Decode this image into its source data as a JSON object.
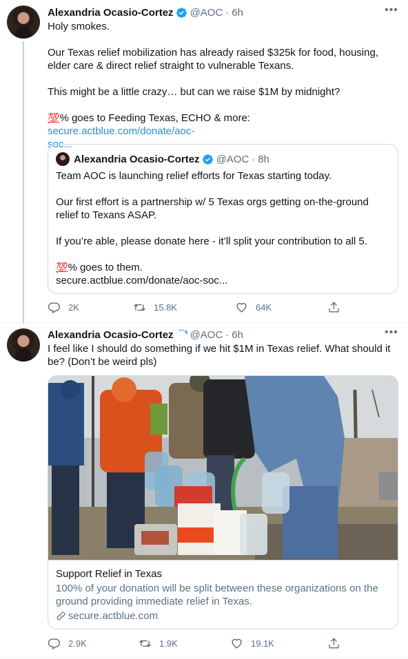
{
  "tweet1": {
    "author_name": "Alexandria Ocasio-Cortez",
    "handle": "@AOC",
    "separator": "·",
    "time": "6h",
    "more_icon": "more-horizontal-icon",
    "lines": [
      "Holy smokes.",
      "Our Texas relief mobilization has already raised $325k for food, housing,",
      "elder care & direct relief straight to vulnerable Texans.",
      "This might be a little crazy… but can we raise $1M by midnight?"
    ],
    "emoji": "💯",
    "last_line_text": "% goes to Feeding Texas, ECHO & more: ",
    "link_part1": "secure.actblue.com/donate/aoc-",
    "link_part2": "soc..."
  },
  "quote": {
    "author_name": "Alexandria Ocasio-Cortez",
    "handle": "@AOC",
    "separator": "·",
    "time": "8h",
    "lines": [
      "Team AOC is launching relief efforts for Texas starting today.",
      "Our first effort is a partnership w/ 5 Texas orgs getting on-the-ground",
      "relief to Texans ASAP.",
      "If you’re able, please donate here - it’ll split your contribution to all 5."
    ],
    "emoji": "💯",
    "last_line_text": "% goes to them.",
    "link": "secure.actblue.com/donate/aoc-soc..."
  },
  "actions1": {
    "replies": "2K",
    "retweets": "15.8K",
    "likes": "64K"
  },
  "tweet2": {
    "author_name": "Alexandria Ocasio-Cortez",
    "handle": "@AOC",
    "separator": "·",
    "time": "6h",
    "lines": [
      "I feel like I should do something if we hit $1M in Texas relief. What should it",
      "be? (Don’t be weird pls)"
    ],
    "card": {
      "title": "Support Relief in Texas",
      "description_line1": "100% of your donation will be split between these organizations on the",
      "description_line2": "ground providing immediate relief in Texas.",
      "domain": "secure.actblue.com"
    }
  },
  "actions2": {
    "replies": "2.9K",
    "retweets": "1.9K",
    "likes": "19.1K"
  },
  "colors": {
    "verified": "#1da1f2",
    "link": "#1b95e0",
    "secondary": "#5b7083",
    "border": "#cfd9de"
  }
}
